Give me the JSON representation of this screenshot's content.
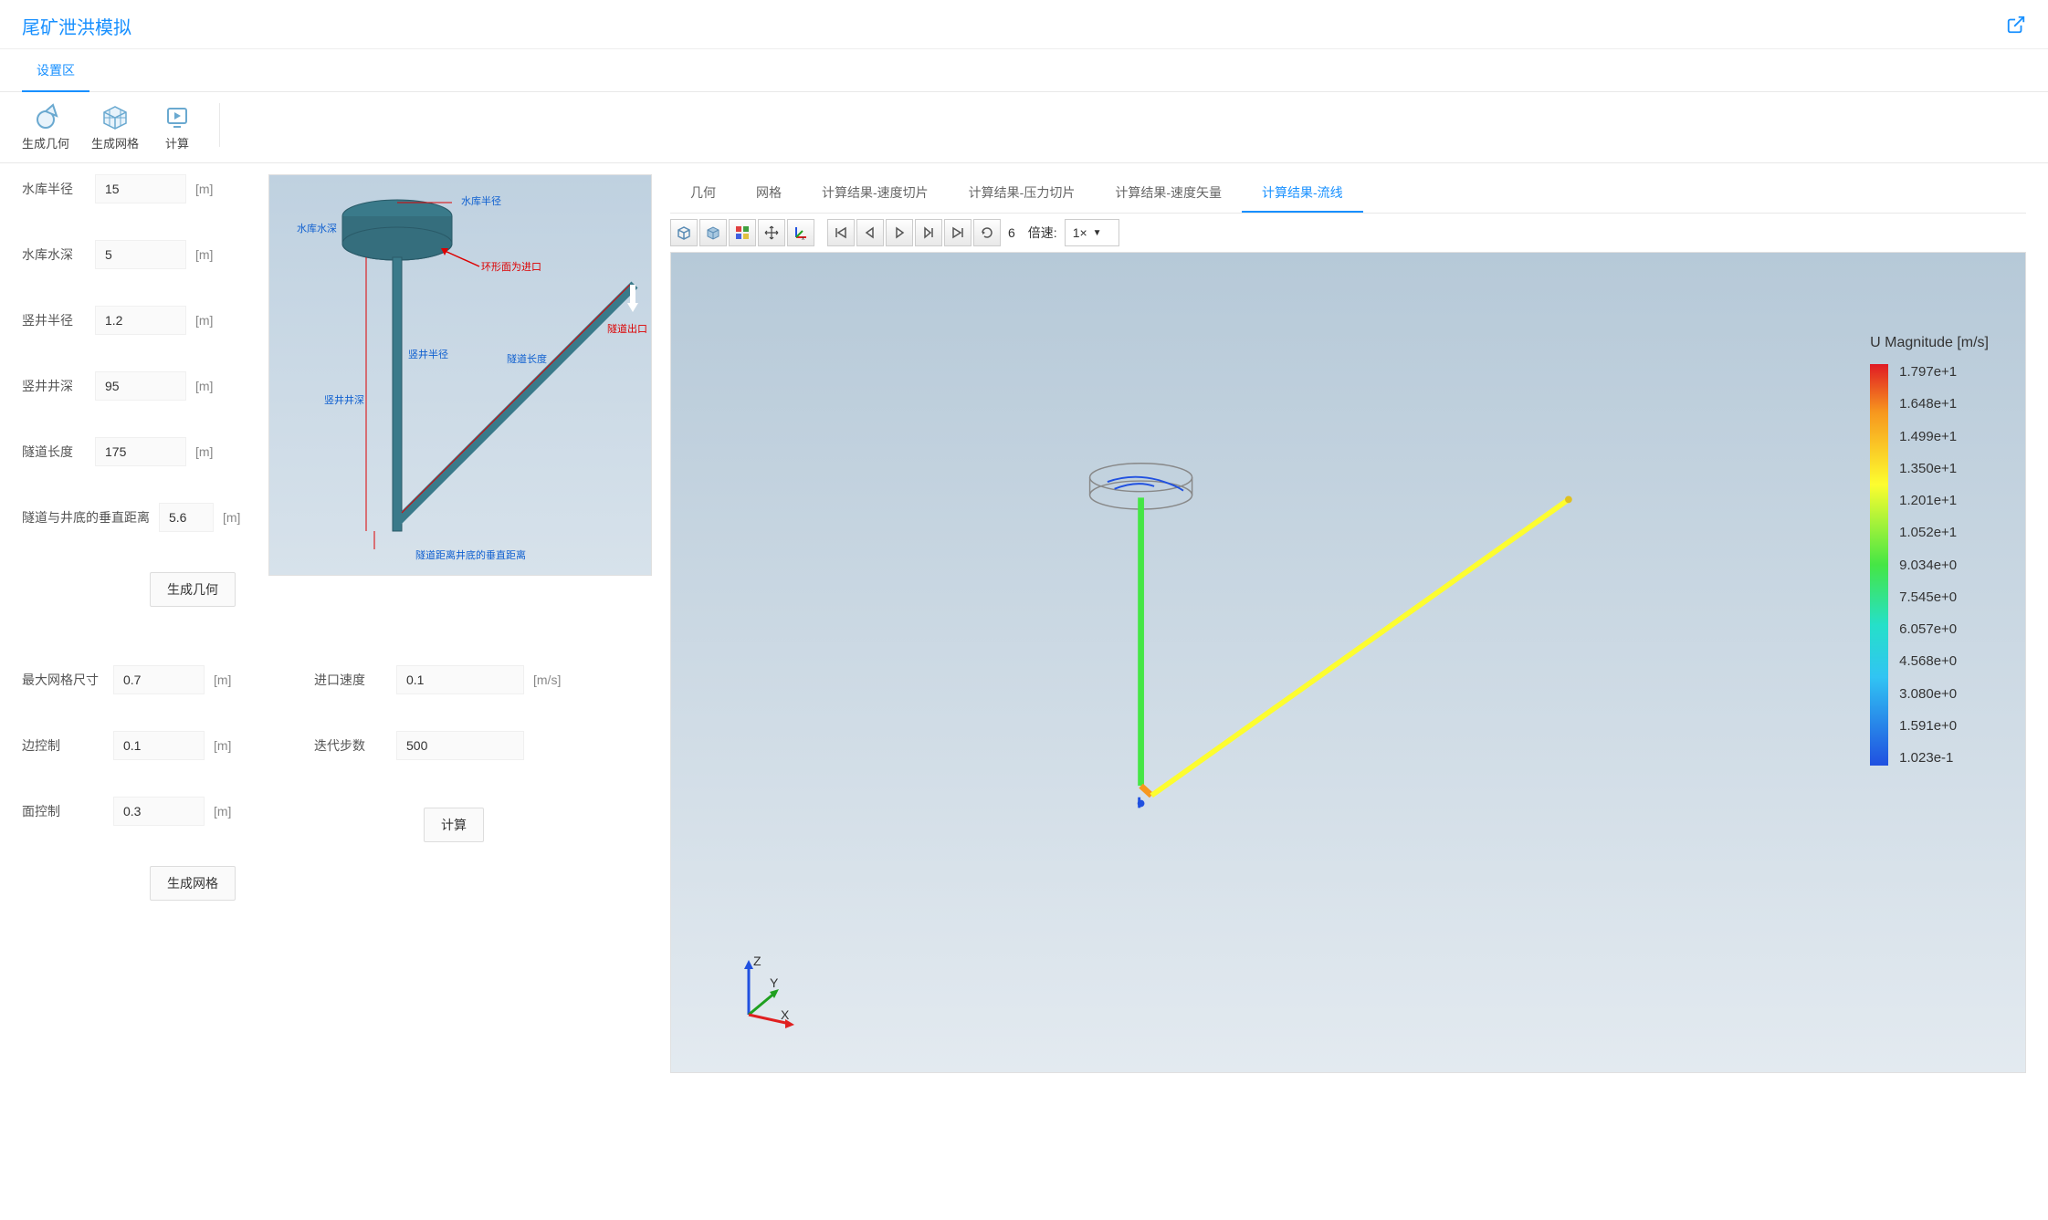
{
  "header": {
    "title": "尾矿泄洪模拟"
  },
  "mainTab": {
    "label": "设置区"
  },
  "toolbar": {
    "geometry": "生成几何",
    "mesh": "生成网格",
    "compute": "计算"
  },
  "geomInputs": {
    "reservoirRadius": {
      "label": "水库半径",
      "value": "15",
      "unit": "[m]"
    },
    "reservoirDepth": {
      "label": "水库水深",
      "value": "5",
      "unit": "[m]"
    },
    "shaftRadius": {
      "label": "竖井半径",
      "value": "1.2",
      "unit": "[m]"
    },
    "shaftDepth": {
      "label": "竖井井深",
      "value": "95",
      "unit": "[m]"
    },
    "tunnelLength": {
      "label": "隧道长度",
      "value": "175",
      "unit": "[m]"
    },
    "tunnelDist": {
      "label": "隧道与井底的垂直距离",
      "value": "5.6",
      "unit": "[m]"
    }
  },
  "geomButton": "生成几何",
  "meshInputs": {
    "maxSize": {
      "label": "最大网格尺寸",
      "value": "0.7",
      "unit": "[m]"
    },
    "edgeCtrl": {
      "label": "边控制",
      "value": "0.1",
      "unit": "[m]"
    },
    "faceCtrl": {
      "label": "面控制",
      "value": "0.3",
      "unit": "[m]"
    }
  },
  "meshButton": "生成网格",
  "simInputs": {
    "inletVel": {
      "label": "进口速度",
      "value": "0.1",
      "unit": "[m/s]"
    },
    "iterSteps": {
      "label": "迭代步数",
      "value": "500"
    }
  },
  "simButton": "计算",
  "diagramLabels": {
    "reservoirRadius": "水库半径",
    "reservoirDepth": "水库水深",
    "ringInlet": "环形面为进口",
    "shaftRadius": "竖井半径",
    "shaftDepth": "竖井井深",
    "tunnelLength": "隧道长度",
    "tunnelOutlet": "隧道出口",
    "tunnelDist": "隧道距离井底的垂直距离"
  },
  "resultTabs": {
    "geometry": "几何",
    "mesh": "网格",
    "velSlice": "计算结果-速度切片",
    "presSlice": "计算结果-压力切片",
    "velVector": "计算结果-速度矢量",
    "streamline": "计算结果-流线"
  },
  "viewerToolbar": {
    "frameNum": "6",
    "speedLabel": "倍速:",
    "speedValue": "1×"
  },
  "legend": {
    "title": "U Magnitude [m/s]",
    "labels": [
      "1.797e+1",
      "1.648e+1",
      "1.499e+1",
      "1.350e+1",
      "1.201e+1",
      "1.052e+1",
      "9.034e+0",
      "7.545e+0",
      "6.057e+0",
      "4.568e+0",
      "3.080e+0",
      "1.591e+0",
      "1.023e-1"
    ]
  },
  "axes": {
    "x": "X",
    "y": "Y",
    "z": "Z"
  }
}
